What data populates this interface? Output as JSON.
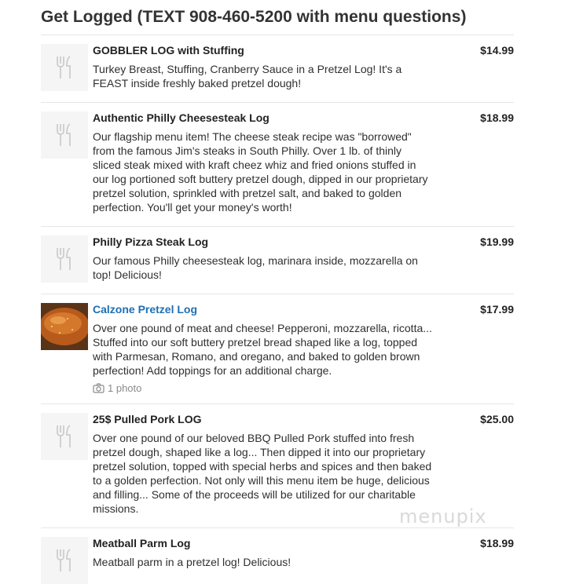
{
  "page": {
    "title": "Get Logged (TEXT 908-460-5200 with menu questions)"
  },
  "colors": {
    "link": "#1f6fb2",
    "thumb_bg": "#f5f5f5",
    "divider": "#e6e6e6"
  },
  "items": [
    {
      "name": "GOBBLER LOG with Stuffing",
      "price": "$14.99",
      "desc": "Turkey Breast, Stuffing, Cranberry Sauce in a Pretzel Log! It's a FEAST inside freshly baked pretzel dough!",
      "icon": "utensils-icon"
    },
    {
      "name": "Authentic Philly Cheesesteak Log",
      "price": "$18.99",
      "desc": "Our flagship menu item! The cheese steak recipe was \"borrowed\" from the famous Jim's steaks in South Philly. Over 1 lb. of thinly sliced steak mixed with kraft cheez whiz and fried onions stuffed in our log portioned soft buttery pretzel dough, dipped in our proprietary pretzel solution, sprinkled with pretzel salt, and baked to golden perfection. You'll get your money's worth!",
      "icon": "utensils-icon"
    },
    {
      "name": "Philly Pizza Steak Log",
      "price": "$19.99",
      "desc": "Our famous Philly cheesesteak log, marinara inside, mozzarella on top! Delicious!",
      "icon": "utensils-icon"
    },
    {
      "name": "Calzone Pretzel Log",
      "price": "$17.99",
      "desc": "Over one pound of meat and cheese! Pepperoni, mozzarella, ricotta... Stuffed into our soft buttery pretzel bread shaped like a log, topped with Parmesan, Romano, and oregano, and baked to golden brown perfection! Add toppings for an additional charge.",
      "photos": "1 photo",
      "icon": "camera-icon"
    },
    {
      "name": "25$ Pulled Pork LOG",
      "price": "$25.00",
      "desc": "Over one pound of our beloved BBQ Pulled Pork stuffed into fresh pretzel dough, shaped like a log... Then dipped it into our proprietary pretzel solution, topped with special herbs and spices and then baked to a golden perfection. Not only will this menu item be huge, delicious and filling... Some of the proceeds will be utilized for our charitable missions.",
      "icon": "utensils-icon"
    },
    {
      "name": "Meatball Parm Log",
      "price": "$18.99",
      "desc": "Meatball parm in a pretzel log! Delicious!",
      "icon": "utensils-icon"
    }
  ],
  "watermark": "menupix"
}
